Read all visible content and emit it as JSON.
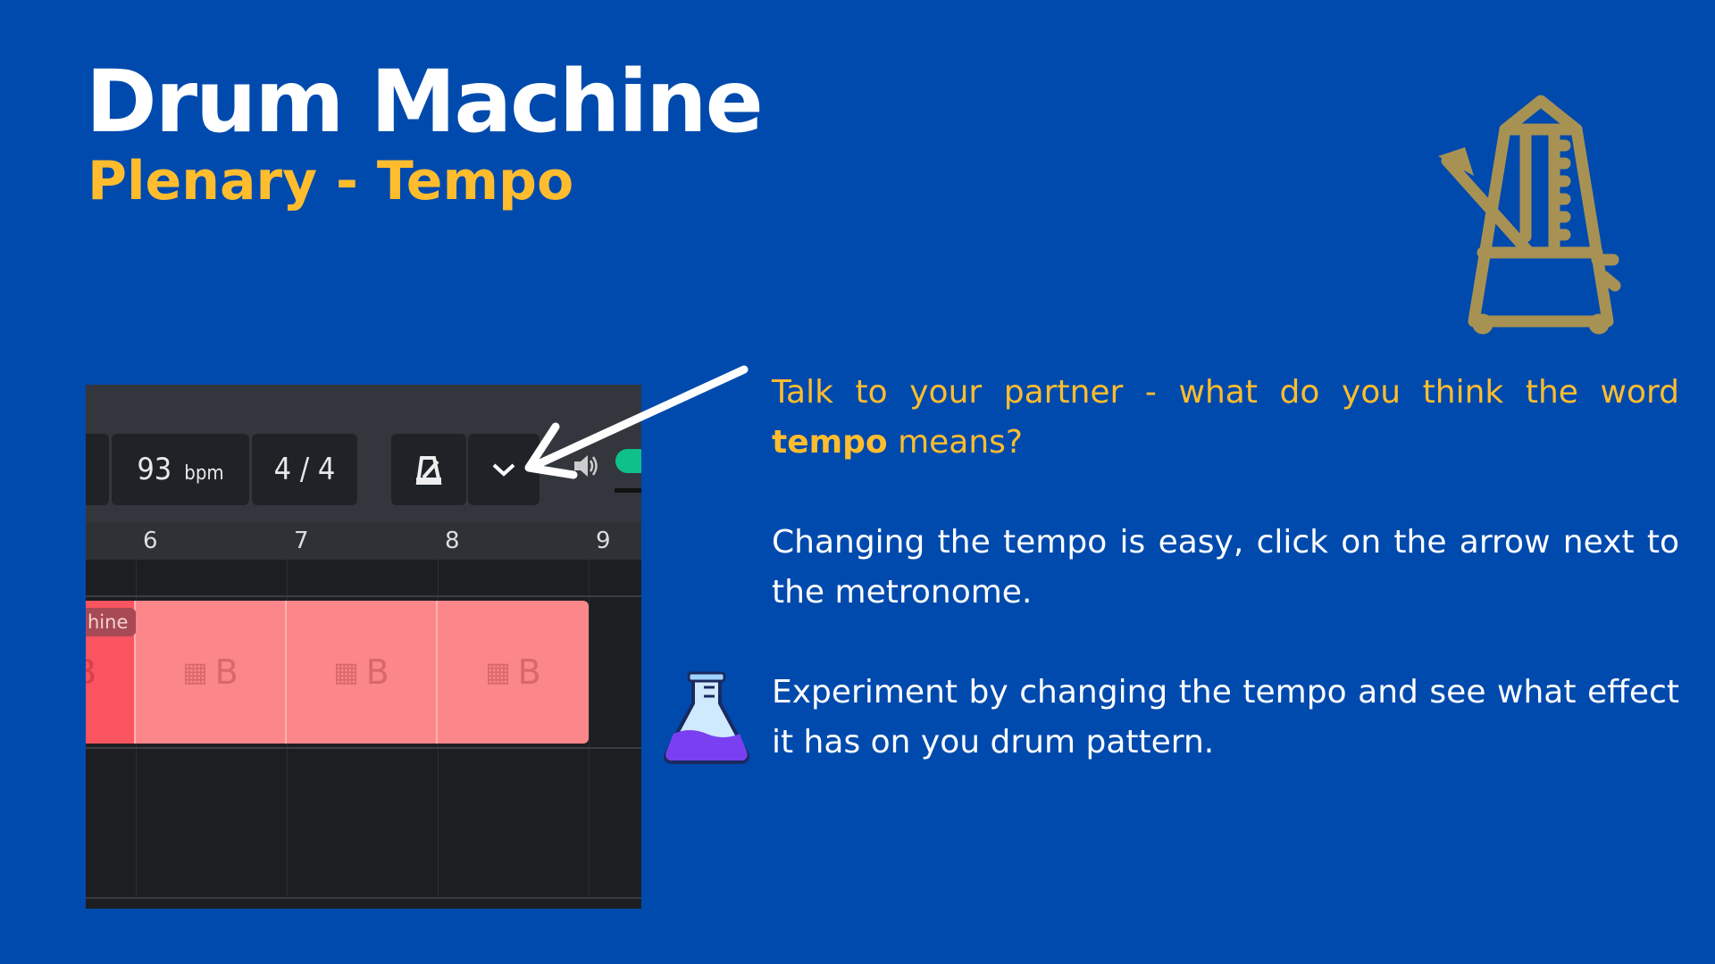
{
  "header": {
    "title": "Drum Machine",
    "subtitle": "Plenary - Tempo"
  },
  "icons": {
    "metronome": "metronome-icon",
    "flask": "flask-icon",
    "arrow": "arrow-icon"
  },
  "colors": {
    "background": "#004aad",
    "accent": "#ffbd2e",
    "icon_gold": "#a89253",
    "clip": "#fb878a"
  },
  "daw": {
    "tempo_value": "93",
    "tempo_unit": "bpm",
    "time_signature": "4 / 4",
    "ruler": [
      "6",
      "7",
      "8",
      "9"
    ],
    "clip_name": "hine",
    "clip_segments": [
      "B",
      "B",
      "B"
    ],
    "clip_first": "B"
  },
  "text": {
    "p1_before": "Talk to your partner - what do you think the word ",
    "p1_bold": "tempo",
    "p1_after": " means?",
    "p2": "Changing the tempo is easy, click on the arrow next to the metronome.",
    "p3": "Experiment by changing the tempo and see what effect it has on you drum pattern."
  }
}
